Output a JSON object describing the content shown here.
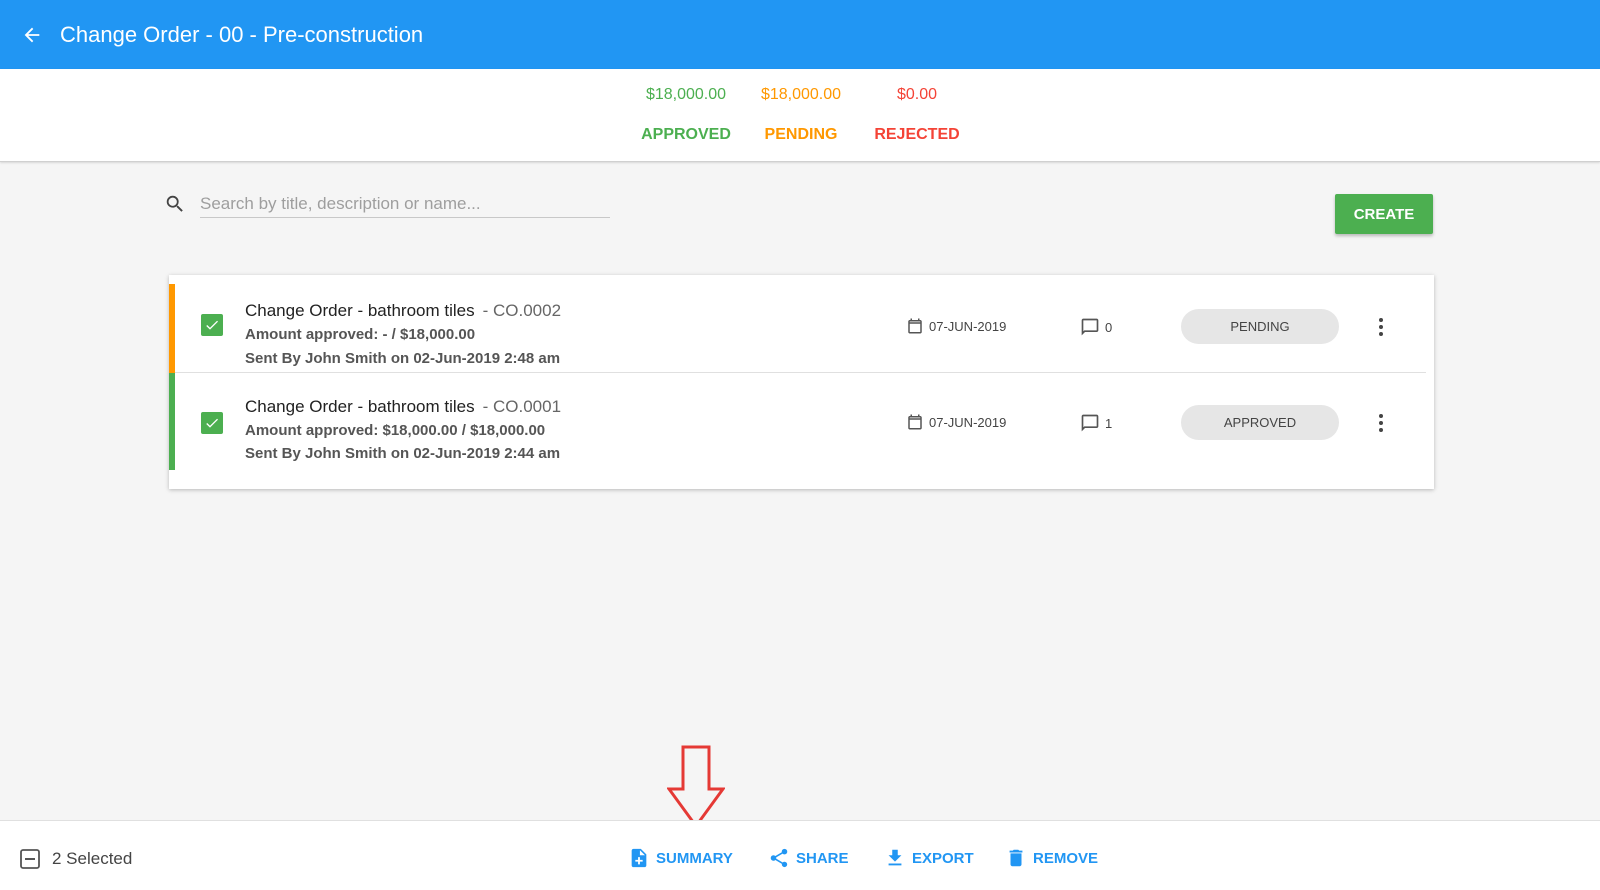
{
  "header": {
    "title": "Change Order - 00 - Pre-construction"
  },
  "summary": {
    "approved": {
      "amount": "$18,000.00",
      "label": "APPROVED",
      "color": "#4caf50"
    },
    "pending": {
      "amount": "$18,000.00",
      "label": "PENDING",
      "color": "#ff9800"
    },
    "rejected": {
      "amount": "$0.00",
      "label": "REJECTED",
      "color": "#f44336"
    }
  },
  "search": {
    "placeholder": "Search by title, description or name...",
    "value": ""
  },
  "toolbar": {
    "create_label": "CREATE"
  },
  "orders": [
    {
      "title": "Change Order - bathroom tiles",
      "code": "- CO.0002",
      "amount": "Amount approved: - / $18,000.00",
      "sent": "Sent By John Smith on 02-Jun-2019 2:48 am",
      "date": "07-JUN-2019",
      "comments": "0",
      "status": "PENDING",
      "accent_color": "#ff9800",
      "checked": true
    },
    {
      "title": "Change Order - bathroom tiles",
      "code": "- CO.0001",
      "amount": "Amount approved: $18,000.00 / $18,000.00",
      "sent": "Sent By John Smith on 02-Jun-2019 2:44 am",
      "date": "07-JUN-2019",
      "comments": "1",
      "status": "APPROVED",
      "accent_color": "#4caf50",
      "checked": true
    }
  ],
  "bottom_bar": {
    "selected_label": "2 Selected",
    "actions": {
      "summary": "SUMMARY",
      "share": "SHARE",
      "export": "EXPORT",
      "remove": "REMOVE"
    }
  },
  "colors": {
    "primary": "#2196f3",
    "create_button": "#4caf50",
    "annotation_arrow": "#e53935"
  },
  "icons": {
    "back": "arrow-left-icon",
    "search": "search-icon",
    "checkbox": "checkbox-checked-icon",
    "calendar": "calendar-icon",
    "comment": "comment-icon",
    "more": "more-vert-icon",
    "deselect": "minus-box-icon",
    "summary": "file-plus-icon",
    "share": "share-icon",
    "export": "download-icon",
    "remove": "trash-icon"
  }
}
